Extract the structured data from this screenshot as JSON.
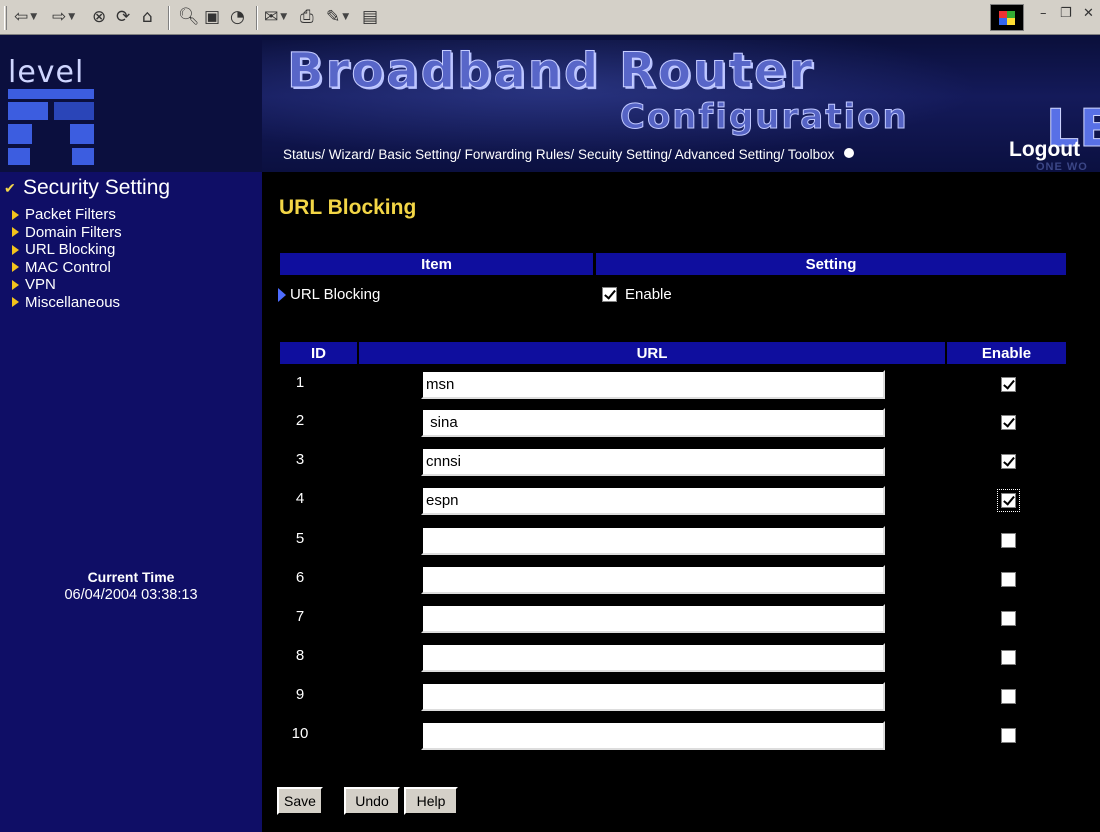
{
  "header": {
    "logo_text": "level",
    "brand_title": "Broadband Router",
    "brand_subtitle": "Configuration",
    "brand_letters": "LE",
    "brand_tagline": "ONE WO",
    "nav": [
      {
        "label": "Status/"
      },
      {
        "label": "Wizard/"
      },
      {
        "label": "Basic Setting/"
      },
      {
        "label": "Forwarding Rules/"
      },
      {
        "label": "Secuity Setting/"
      },
      {
        "label": "Advanced Setting/"
      },
      {
        "label": "Toolbox"
      }
    ],
    "logout": "Logout"
  },
  "sidebar": {
    "title": "Security Setting",
    "items": [
      {
        "label": "Packet Filters"
      },
      {
        "label": "Domain Filters"
      },
      {
        "label": "URL Blocking"
      },
      {
        "label": "MAC Control"
      },
      {
        "label": "VPN"
      },
      {
        "label": "Miscellaneous"
      }
    ],
    "current_time_label": "Current Time",
    "current_time_value": "06/04/2004 03:38:13"
  },
  "main": {
    "title": "URL Blocking",
    "settings_table": {
      "col_item": "Item",
      "col_setting": "Setting",
      "row_label": "URL Blocking",
      "enable_label": "Enable",
      "enable_checked": true
    },
    "url_table": {
      "col_id": "ID",
      "col_url": "URL",
      "col_enable": "Enable",
      "rows": [
        {
          "id": "1",
          "url": "msn",
          "enabled": true
        },
        {
          "id": "2",
          "url": " sina",
          "enabled": true
        },
        {
          "id": "3",
          "url": "cnnsi",
          "enabled": true
        },
        {
          "id": "4",
          "url": "espn",
          "enabled": true
        },
        {
          "id": "5",
          "url": "",
          "enabled": false
        },
        {
          "id": "6",
          "url": "",
          "enabled": false
        },
        {
          "id": "7",
          "url": "",
          "enabled": false
        },
        {
          "id": "8",
          "url": "",
          "enabled": false
        },
        {
          "id": "9",
          "url": "",
          "enabled": false
        },
        {
          "id": "10",
          "url": "",
          "enabled": false
        }
      ]
    },
    "buttons": {
      "save": "Save",
      "undo": "Undo",
      "help": "Help"
    }
  },
  "toolbar": {
    "icons": [
      "back-icon",
      "forward-icon",
      "stop-icon",
      "refresh-icon",
      "home-icon",
      "search-icon",
      "favorites-icon",
      "history-icon",
      "mail-icon",
      "print-icon",
      "edit-icon",
      "discuss-icon"
    ]
  }
}
